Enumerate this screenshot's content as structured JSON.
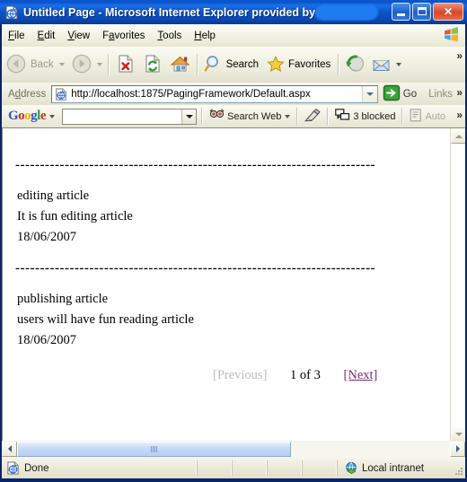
{
  "window": {
    "title_text": "Untitled Page - Microsoft Internet Explorer provided by",
    "title_redacted": true,
    "icon": "ie-page-icon",
    "controls": {
      "minimize": "Minimize",
      "maximize": "Maximize",
      "close": "Close"
    }
  },
  "menu": {
    "items": [
      {
        "label": "File",
        "accel": "F"
      },
      {
        "label": "Edit",
        "accel": "E"
      },
      {
        "label": "View",
        "accel": "V"
      },
      {
        "label": "Favorites",
        "accel": "a"
      },
      {
        "label": "Tools",
        "accel": "T"
      },
      {
        "label": "Help",
        "accel": "H"
      }
    ],
    "brand_icon": "windows-flag-icon"
  },
  "toolbar": {
    "back_label": "Back",
    "forward_label": "",
    "stop_label": "",
    "refresh_label": "",
    "home_label": "",
    "search_label": "Search",
    "favorites_label": "Favorites",
    "history_label": "",
    "mail_label": "",
    "overflow_chevron": "»"
  },
  "address": {
    "label": "Address",
    "label_accel": "d",
    "url": "http://localhost:1875/PagingFramework/Default.aspx",
    "go_label": "Go",
    "links_label": "Links",
    "overflow_chevron": "»"
  },
  "google_toolbar": {
    "logo": "Google",
    "search_value": "",
    "search_placeholder": "",
    "search_web_label": "Search Web",
    "highlight_label": "",
    "blocked_label": "3 blocked",
    "autofill_label": "Auto",
    "overflow_chevron": "»"
  },
  "page": {
    "separator": "-------------------------------------------------------------------------",
    "articles": [
      {
        "title": "editing article",
        "body": "It is fun editing article",
        "date": "18/06/2007"
      },
      {
        "title": "publishing article",
        "body": "users will have fun reading article",
        "date": "18/06/2007"
      }
    ],
    "pager": {
      "previous_label": "[Previous]",
      "previous_enabled": false,
      "count_label": "1 of 3",
      "next_label": "[Next]",
      "next_enabled": true,
      "next_color": "#7c2a7c",
      "previous_color": "#bdbdbd"
    }
  },
  "statusbar": {
    "status_text": "Done",
    "zone_text": "Local intranet",
    "zone_icon": "globe-icon",
    "status_icon": "ie-page-icon"
  }
}
